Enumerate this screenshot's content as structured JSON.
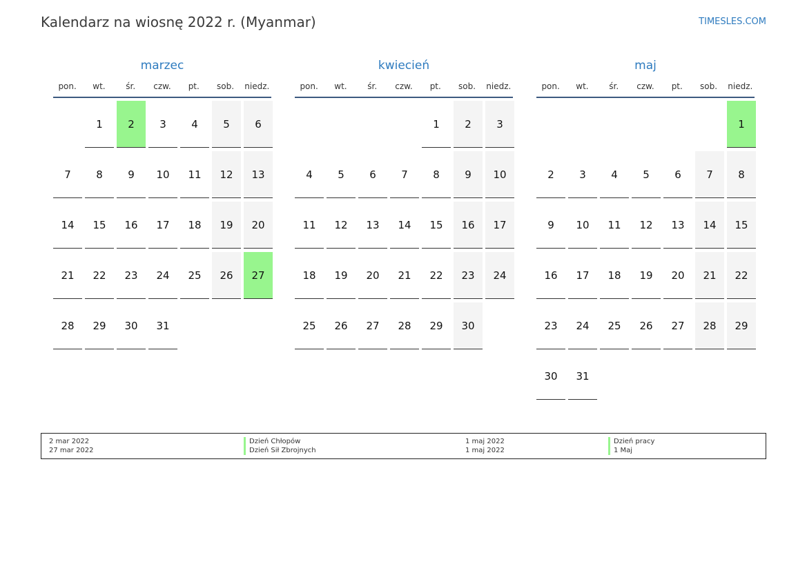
{
  "title": "Kalendarz na wiosnę 2022 r. (Myanmar)",
  "brand": "TIMESLES.COM",
  "colors": {
    "accent": "#2e7bbf",
    "holiday": "#98f58e",
    "weekend": "#f4f4f4",
    "rule": "#3d5a80"
  },
  "weekdays": [
    "pon.",
    "wt.",
    "śr.",
    "czw.",
    "pt.",
    "sob.",
    "niedz."
  ],
  "months": [
    {
      "name": "marzec",
      "offset": 1,
      "days": 31,
      "holidays": [
        2,
        27
      ]
    },
    {
      "name": "kwiecień",
      "offset": 4,
      "days": 30,
      "holidays": []
    },
    {
      "name": "maj",
      "offset": 6,
      "days": 31,
      "holidays": [
        1
      ]
    }
  ],
  "legend": {
    "left_dates": [
      "2 mar 2022",
      "27 mar 2022"
    ],
    "left_names": [
      "Dzień Chłopów",
      "Dzień Sił Zbrojnych"
    ],
    "right_dates": [
      "1 maj 2022",
      "1 maj 2022"
    ],
    "right_names": [
      "Dzień pracy",
      "1 Maj"
    ]
  }
}
